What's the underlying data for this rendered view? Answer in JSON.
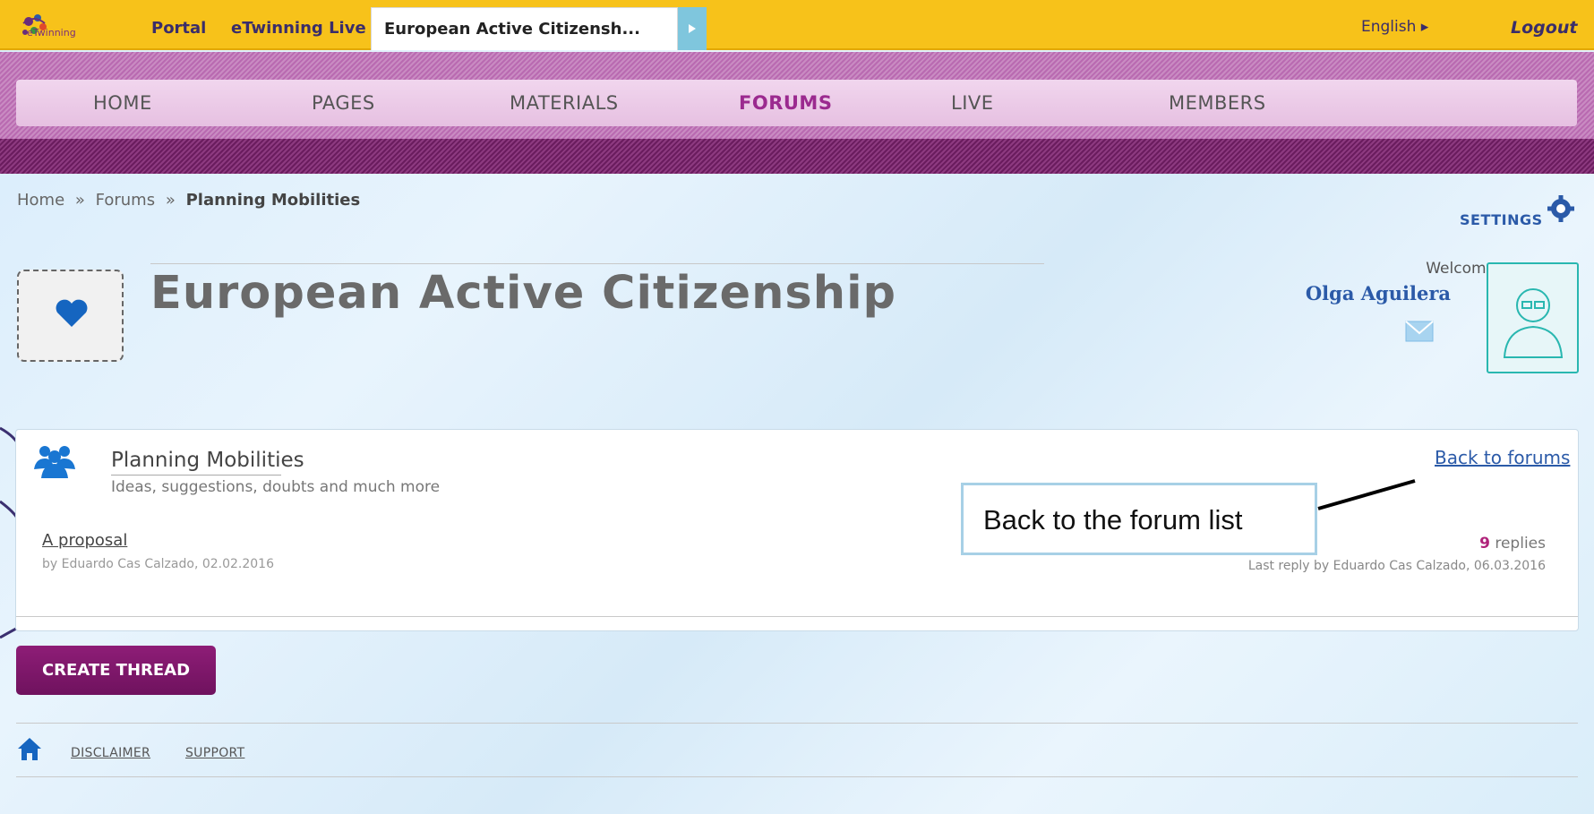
{
  "topbar": {
    "logo_text": "eTwinning",
    "tabs": [
      {
        "label": "Portal"
      },
      {
        "label": "eTwinning Live"
      },
      {
        "label": "European Active Citizensh..."
      }
    ],
    "language": "English ▸",
    "logout": "Logout"
  },
  "nav": {
    "items": [
      {
        "label": "HOME"
      },
      {
        "label": "PAGES"
      },
      {
        "label": "MATERIALS"
      },
      {
        "label": "FORUMS"
      },
      {
        "label": "LIVE"
      },
      {
        "label": "MEMBERS"
      }
    ]
  },
  "breadcrumb": {
    "home": "Home",
    "sep": "»",
    "forums": "Forums",
    "current": "Planning Mobilities"
  },
  "settings_label": "SETTINGS",
  "header": {
    "title": "European Active Citizenship",
    "welcome": "Welcome",
    "username": "Olga Aguilera"
  },
  "forum": {
    "name": "Planning Mobilities",
    "description": "Ideas, suggestions, doubts and much more",
    "back_link": "Back to forums",
    "threads": [
      {
        "title": "A proposal",
        "meta": "by Eduardo Cas Calzado, 02.02.2016",
        "reply_count": "9",
        "reply_label": "replies",
        "last_reply": "Last reply by Eduardo Cas Calzado, 06.03.2016"
      }
    ]
  },
  "callout": "Back to the forum list",
  "create_thread": "CREATE THREAD",
  "footer": {
    "links": [
      "DISCLAIMER",
      "SUPPORT"
    ]
  },
  "colors": {
    "topbar": "#f7c21a",
    "nav_active": "#9b2a8f",
    "link": "#2b5aa8",
    "create_button": "#7e176a",
    "avatar_border": "#29b7b0"
  }
}
